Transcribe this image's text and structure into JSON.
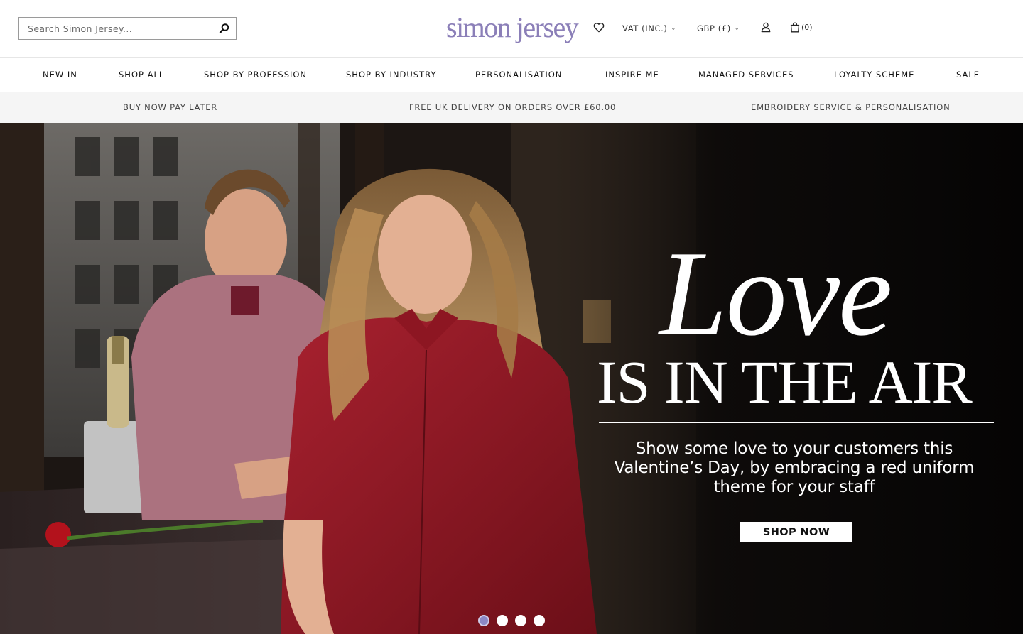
{
  "header": {
    "search": {
      "placeholder": "Search Simon Jersey...",
      "value": ""
    },
    "logo_text": "simon jersey",
    "vat_label": "VAT (INC.)",
    "currency_label": "GBP (£)",
    "cart_count": "(0)",
    "brand_color": "#8b7fb8"
  },
  "nav": {
    "items": [
      {
        "label": "NEW IN"
      },
      {
        "label": "SHOP ALL"
      },
      {
        "label": "SHOP BY PROFESSION"
      },
      {
        "label": "SHOP BY INDUSTRY"
      },
      {
        "label": "PERSONALISATION"
      },
      {
        "label": "INSPIRE ME"
      },
      {
        "label": "MANAGED SERVICES"
      },
      {
        "label": "LOYALTY SCHEME"
      },
      {
        "label": "SALE"
      }
    ]
  },
  "usp": {
    "items": [
      {
        "label": "BUY NOW PAY LATER"
      },
      {
        "label": "FREE UK DELIVERY ON ORDERS OVER £60.00"
      },
      {
        "label": "EMBROIDERY SERVICE & PERSONALISATION"
      }
    ]
  },
  "hero": {
    "headline_script": "Love",
    "headline_caps": "IS IN THE AIR",
    "subtext": "Show some love to your customers this Valentine’s Day, by embracing a red uniform theme for your staff",
    "cta_label": "SHOP NOW",
    "slide_count": 4,
    "active_slide": 1,
    "dot_active_color": "#8b87c4"
  },
  "icons": {
    "search": "search-icon",
    "wishlist": "heart-icon",
    "account": "user-icon",
    "cart": "shopping-bag-icon"
  }
}
